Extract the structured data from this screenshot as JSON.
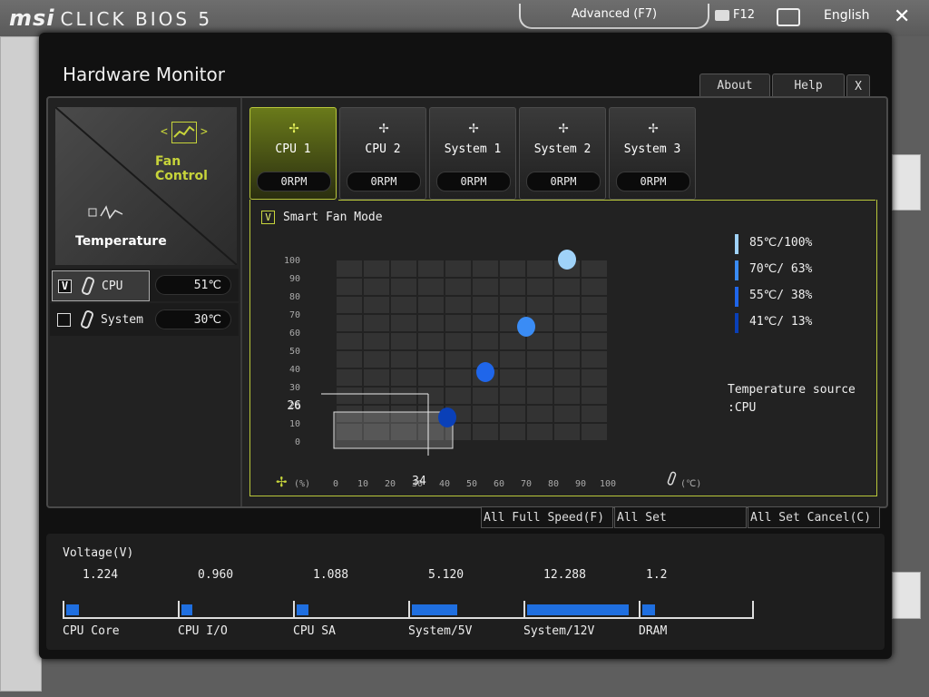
{
  "topbar": {
    "logo_main": "msi",
    "logo_sub": "CLICK BIOS 5",
    "mode_label": "Advanced (F7)",
    "screenshot_label": "F12",
    "language": "English",
    "close_glyph": "✕"
  },
  "dialog": {
    "title": "Hardware Monitor",
    "about_label": "About",
    "help_label": "Help",
    "close_label": "X"
  },
  "modes": {
    "fan_control": "Fan Control",
    "temperature": "Temperature",
    "arrow_left": "<",
    "arrow_right": ">"
  },
  "sensors": [
    {
      "name": "CPU",
      "value": "51℃",
      "checked": "V",
      "selected": true
    },
    {
      "name": "System",
      "value": "30℃",
      "checked": "",
      "selected": false
    }
  ],
  "fans": [
    {
      "name": "CPU 1",
      "rpm": "0RPM",
      "active": true
    },
    {
      "name": "CPU 2",
      "rpm": "0RPM",
      "active": false
    },
    {
      "name": "System 1",
      "rpm": "0RPM",
      "active": false
    },
    {
      "name": "System 2",
      "rpm": "0RPM",
      "active": false
    },
    {
      "name": "System 3",
      "rpm": "0RPM",
      "active": false
    }
  ],
  "smart_fan": {
    "checked": "V",
    "label": "Smart Fan Mode"
  },
  "chart_data": {
    "type": "scatter",
    "x_ticks": [
      "0",
      "10",
      "20",
      "30",
      "40",
      "50",
      "60",
      "70",
      "80",
      "90",
      "100"
    ],
    "y_ticks": [
      "0",
      "10",
      "20",
      "30",
      "40",
      "50",
      "60",
      "70",
      "80",
      "90",
      "100"
    ],
    "xlim": [
      0,
      100
    ],
    "ylim": [
      0,
      100
    ],
    "grid": true,
    "x_unit": "(℃)",
    "y_unit": "(%)",
    "points": [
      {
        "x": 41,
        "y": 13,
        "color": "#0a40b8"
      },
      {
        "x": 55,
        "y": 38,
        "color": "#1f66ea"
      },
      {
        "x": 70,
        "y": 63,
        "color": "#3a8cf5"
      },
      {
        "x": 85,
        "y": 100,
        "color": "#9fd2f8"
      }
    ],
    "cursor": {
      "x": 34,
      "y": 26,
      "x_label": "34",
      "y_label": "26"
    }
  },
  "legend": [
    {
      "label": "85℃/100%",
      "color": "#9fd2f8"
    },
    {
      "label": "70℃/ 63%",
      "color": "#3a8cf5"
    },
    {
      "label": "55℃/ 38%",
      "color": "#1f66ea"
    },
    {
      "label": "41℃/ 13%",
      "color": "#0a40b8"
    }
  ],
  "temp_source": {
    "line1": "Temperature source",
    "line2": ":CPU"
  },
  "actions": {
    "full_speed": "All Full Speed(F)",
    "set_default": "All Set Default(D)",
    "set_cancel": "All Set Cancel(C)"
  },
  "voltage": {
    "title": "Voltage(V)",
    "items": [
      {
        "name": "CPU Core",
        "value": "1.224",
        "level": 0.12
      },
      {
        "name": "CPU I/O",
        "value": "0.960",
        "level": 0.1
      },
      {
        "name": "CPU SA",
        "value": "1.088",
        "level": 0.11
      },
      {
        "name": "System/5V",
        "value": "5.120",
        "level": 0.42
      },
      {
        "name": "System/12V",
        "value": "12.288",
        "level": 0.95
      },
      {
        "name": "DRAM",
        "value": "1.2",
        "level": 0.12
      }
    ]
  },
  "colors": {
    "accent": "#c8d63c",
    "bar": "#1f6fe0"
  }
}
